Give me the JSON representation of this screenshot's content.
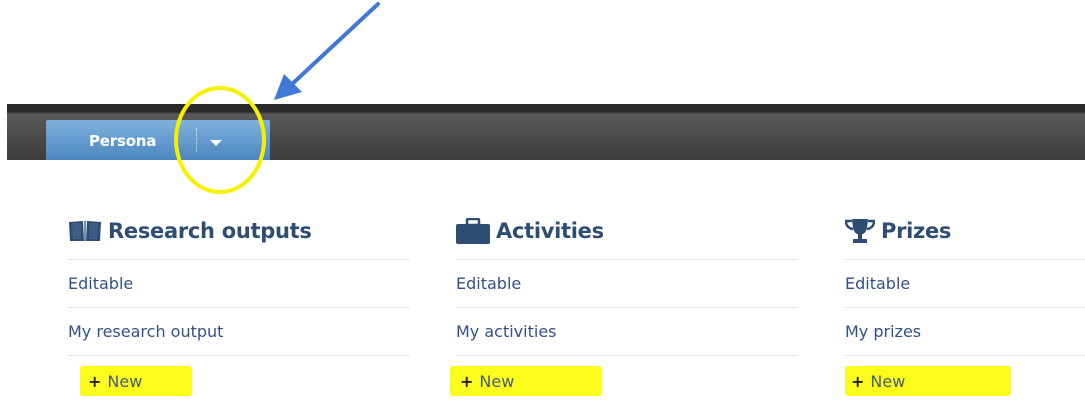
{
  "annotations": {
    "arrow_color": "#3f78d6",
    "circle_color": "#f7f000",
    "highlight_color": "#fbfb1c"
  },
  "topbar": {
    "tab_label": "Persona",
    "tab_dropdown_icon": "caret-down-icon"
  },
  "columns": [
    {
      "title": "Research outputs",
      "icon": "book-icon",
      "rows": [
        "Editable",
        "My research output"
      ],
      "new_label": "New",
      "new_icon": "plus-icon"
    },
    {
      "title": "Activities",
      "icon": "briefcase-icon",
      "rows": [
        "Editable",
        "My activities"
      ],
      "new_label": "New",
      "new_icon": "plus-icon"
    },
    {
      "title": "Prizes",
      "icon": "trophy-icon",
      "rows": [
        "Editable",
        "My prizes"
      ],
      "new_label": "New",
      "new_icon": "plus-icon"
    }
  ],
  "colors": {
    "title": "#2f4c73",
    "link": "#33508a",
    "tab": "#4d87c0"
  }
}
